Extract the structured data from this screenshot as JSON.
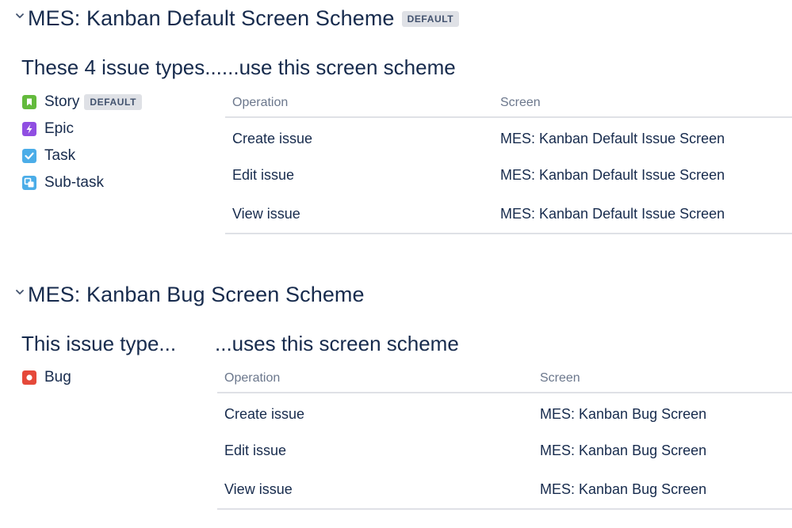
{
  "schemes": [
    {
      "title": "MES: Kanban Default Screen Scheme",
      "badge": "DEFAULT",
      "types_heading": "These 4 issue types......use this screen scheme",
      "issue_types": [
        {
          "name": "Story",
          "badge": "DEFAULT",
          "icon": "story-icon",
          "color": "#63ba3c"
        },
        {
          "name": "Epic",
          "icon": "epic-icon",
          "color": "#904ee2"
        },
        {
          "name": "Task",
          "icon": "task-icon",
          "color": "#4bade8"
        },
        {
          "name": "Sub-task",
          "icon": "subtask-icon",
          "color": "#4bade8"
        }
      ],
      "table": {
        "headers": [
          "Operation",
          "Screen"
        ],
        "rows": [
          [
            "Create issue",
            "MES: Kanban Default Issue Screen"
          ],
          [
            "Edit issue",
            "MES: Kanban Default Issue Screen"
          ],
          [
            "View issue",
            "MES: Kanban Default Issue Screen"
          ]
        ]
      }
    },
    {
      "title": "MES: Kanban Bug Screen Scheme",
      "types_heading": "This issue type...",
      "uses_heading": "...uses this screen scheme",
      "issue_types": [
        {
          "name": "Bug",
          "icon": "bug-icon",
          "color": "#e5493a"
        }
      ],
      "table": {
        "headers": [
          "Operation",
          "Screen"
        ],
        "rows": [
          [
            "Create issue",
            "MES: Kanban Bug Screen"
          ],
          [
            "Edit issue",
            "MES: Kanban Bug Screen"
          ],
          [
            "View issue",
            "MES: Kanban Bug Screen"
          ]
        ]
      }
    }
  ]
}
